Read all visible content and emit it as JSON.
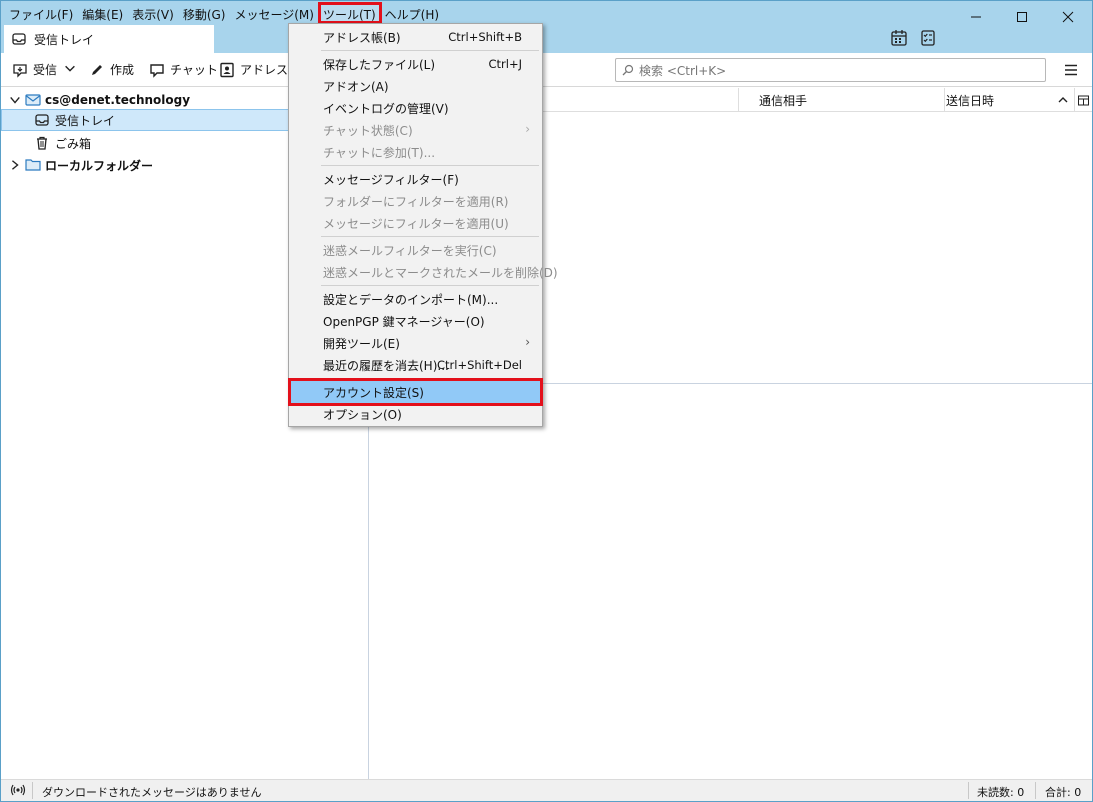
{
  "menubar": [
    {
      "label": "ファイル(F)",
      "name": "menu-file"
    },
    {
      "label": "編集(E)",
      "name": "menu-edit"
    },
    {
      "label": "表示(V)",
      "name": "menu-view"
    },
    {
      "label": "移動(G)",
      "name": "menu-go"
    },
    {
      "label": "メッセージ(M)",
      "name": "menu-message"
    },
    {
      "label": "ツール(T)",
      "name": "menu-tools"
    },
    {
      "label": "ヘルプ(H)",
      "name": "menu-help"
    }
  ],
  "tab": {
    "label": "受信トレイ",
    "icon": "inbox-icon"
  },
  "toolbar": {
    "get_messages": "受信",
    "write": "作成",
    "chat": "チャット",
    "address_book": "アドレス帳"
  },
  "search": {
    "placeholder": "検索 <Ctrl+K>"
  },
  "folders": {
    "account": "cs@denet.technology",
    "inbox": "受信トレイ",
    "trash": "ごみ箱",
    "local": "ローカルフォルダー"
  },
  "columns": {
    "correspondent": "通信相手",
    "date": "送信日時"
  },
  "tools_menu": {
    "address_book": {
      "label": "アドレス帳(B)",
      "shortcut": "Ctrl+Shift+B"
    },
    "saved_files": {
      "label": "保存したファイル(L)",
      "shortcut": "Ctrl+J"
    },
    "addons": {
      "label": "アドオン(A)"
    },
    "event_log": {
      "label": "イベントログの管理(V)"
    },
    "chat_status": {
      "label": "チャット状態(C)"
    },
    "join_chat": {
      "label": "チャットに参加(T)..."
    },
    "message_filters": {
      "label": "メッセージフィルター(F)"
    },
    "run_filters_folder": {
      "label": "フォルダーにフィルターを適用(R)"
    },
    "run_filters_message": {
      "label": "メッセージにフィルターを適用(U)"
    },
    "run_junk_filter": {
      "label": "迷惑メールフィルターを実行(C)"
    },
    "delete_junk": {
      "label": "迷惑メールとマークされたメールを削除(D)"
    },
    "import": {
      "label": "設定とデータのインポート(M)..."
    },
    "openpgp": {
      "label": "OpenPGP 鍵マネージャー(O)"
    },
    "dev_tools": {
      "label": "開発ツール(E)"
    },
    "clear_history": {
      "label": "最近の履歴を消去(H)...",
      "shortcut": "Ctrl+Shift+Del"
    },
    "account_settings": {
      "label": "アカウント設定(S)"
    },
    "options": {
      "label": "オプション(O)"
    }
  },
  "statusbar": {
    "message": "ダウンロードされたメッセージはありません",
    "unread": "未読数: 0",
    "total": "合計: 0"
  },
  "colors": {
    "titlebar": "#a8d4ec",
    "highlight": "#91c9f7",
    "annotation": "#e3101b"
  }
}
